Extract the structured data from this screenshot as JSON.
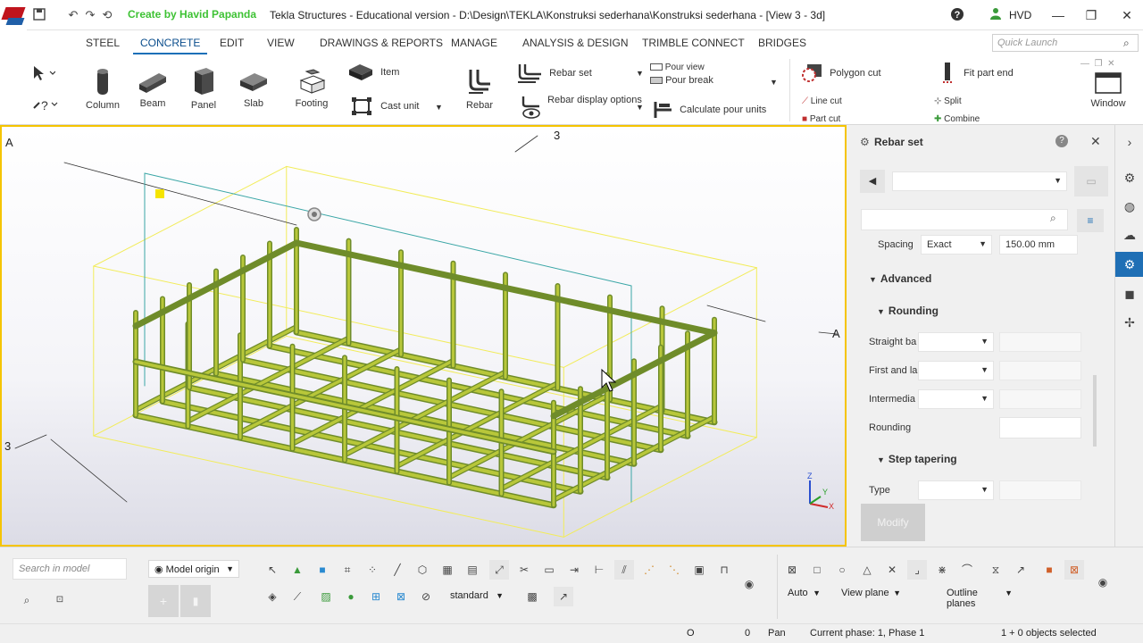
{
  "title_bar": {
    "creator_text": "Create by Havid Papanda",
    "window_title": "Tekla Structures - Educational version - D:\\Design\\TEKLA\\Konstruksi sederhana\\Konstruksi sederhana - [View 3 - 3d]",
    "user": "HVD",
    "help_icon": "?"
  },
  "menu": {
    "tabs": [
      "STEEL",
      "CONCRETE",
      "EDIT",
      "VIEW",
      "DRAWINGS & REPORTS",
      "MANAGE",
      "ANALYSIS & DESIGN",
      "TRIMBLE CONNECT",
      "BRIDGES"
    ],
    "active_tab": "CONCRETE",
    "quick_launch_placeholder": "Quick Launch"
  },
  "ribbon": {
    "column": "Column",
    "beam": "Beam",
    "panel": "Panel",
    "slab": "Slab",
    "footing": "Footing",
    "item": "Item",
    "cast_unit": "Cast unit",
    "rebar": "Rebar",
    "rebar_set": "Rebar set",
    "rebar_display_options": "Rebar display options",
    "pour_view": "Pour view",
    "pour_break": "Pour break",
    "calculate_pour_units": "Calculate pour units",
    "polygon_cut": "Polygon cut",
    "line_cut": "Line cut",
    "part_cut": "Part cut",
    "fit_part_end": "Fit part end",
    "split": "Split",
    "combine": "Combine",
    "window": "Window"
  },
  "viewport": {
    "grid_labels": {
      "a_left": "A",
      "a_right": "A",
      "three_top": "3",
      "three_left": "3"
    },
    "axis": {
      "z": "Z",
      "y": "Y",
      "x": "X"
    }
  },
  "panel": {
    "title": "Rebar set",
    "spacing_label": "Spacing",
    "spacing_mode": "Exact",
    "spacing_value": "150.00 mm",
    "advanced": "Advanced",
    "rounding_section": "Rounding",
    "straight_label": "Straight ba",
    "first_last_label": "First and la",
    "intermediate_label": "Intermedia",
    "rounding_label": "Rounding",
    "step_tapering": "Step tapering",
    "type_label": "Type",
    "modify_button": "Modify"
  },
  "bottom": {
    "search_placeholder": "Search in model",
    "model_origin": "Model origin",
    "standard": "standard",
    "auto": "Auto",
    "view_plane": "View plane",
    "outline_planes": "Outline planes"
  },
  "status": {
    "o_value": "O",
    "zero": "0",
    "pan": "Pan",
    "phase": "Current phase: 1, Phase 1",
    "selected": "1 + 0 objects selected"
  },
  "colors": {
    "rebar_light": "#b8c73a",
    "rebar_dark": "#6f8c2a",
    "viewport_border": "#f5c400",
    "accent": "#1f6fb5",
    "creator": "#3ec234"
  }
}
